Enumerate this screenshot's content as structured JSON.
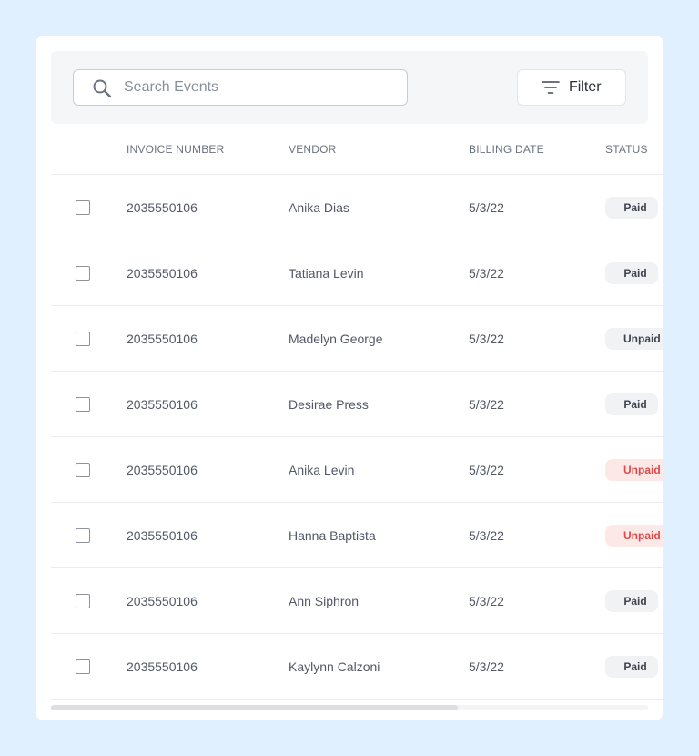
{
  "search": {
    "placeholder": "Search Events",
    "value": "",
    "icon": "search-icon"
  },
  "filter": {
    "label": "Filter",
    "icon": "filter-icon"
  },
  "table": {
    "columns": [
      "INVOICE NUMBER",
      "VENDOR",
      "BILLING DATE",
      "STATUS"
    ],
    "rows": [
      {
        "invoice": "2035550106",
        "vendor": "Anika Dias",
        "date": "5/3/22",
        "status": "Paid"
      },
      {
        "invoice": "2035550106",
        "vendor": "Tatiana Levin",
        "date": "5/3/22",
        "status": "Paid"
      },
      {
        "invoice": "2035550106",
        "vendor": "Madelyn George",
        "date": "5/3/22",
        "status": "Unpaid"
      },
      {
        "invoice": "2035550106",
        "vendor": "Desirae Press",
        "date": "5/3/22",
        "status": "Paid"
      },
      {
        "invoice": "2035550106",
        "vendor": "Anika Levin",
        "date": "5/3/22",
        "status": "Unpaid"
      },
      {
        "invoice": "2035550106",
        "vendor": "Hanna Baptista",
        "date": "5/3/22",
        "status": "Unpaid"
      },
      {
        "invoice": "2035550106",
        "vendor": "Ann Siphron",
        "date": "5/3/22",
        "status": "Paid"
      },
      {
        "invoice": "2035550106",
        "vendor": "Kaylynn Calzoni",
        "date": "5/3/22",
        "status": "Paid"
      }
    ],
    "status_styles": [
      "neutral",
      "neutral",
      "neutral",
      "neutral",
      "danger",
      "danger",
      "neutral",
      "neutral"
    ]
  },
  "colors": {
    "background": "#e1f0fe",
    "card": "#ffffff",
    "toolbar": "#f5f6f8",
    "badge_neutral_bg": "#f1f2f4",
    "badge_danger_bg": "#fde8e8",
    "badge_danger_text": "#e04848"
  },
  "scroll": {
    "horizontal_position": 0,
    "visible_fraction": 0.68
  }
}
